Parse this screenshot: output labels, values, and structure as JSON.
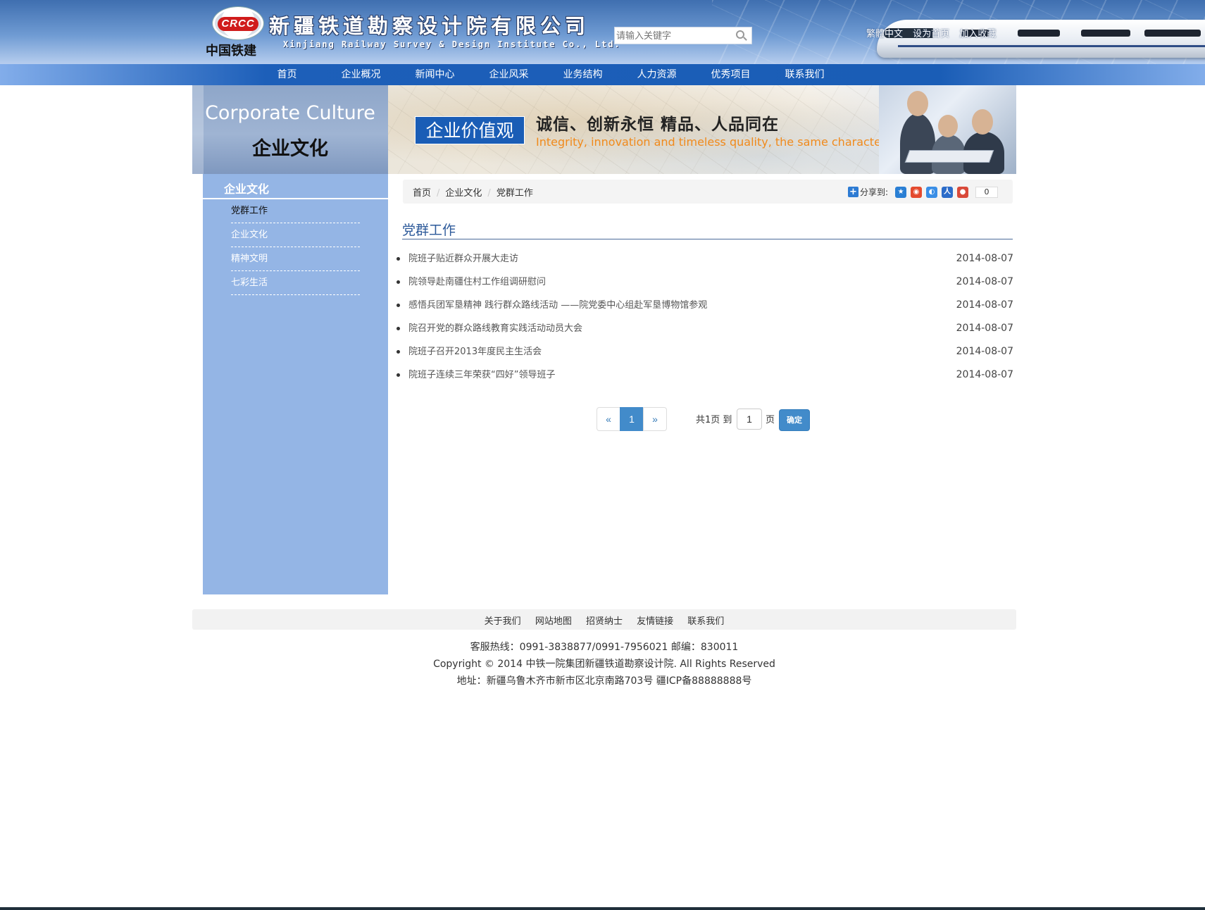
{
  "header": {
    "logo_mark": "CRCC",
    "logo_cn": "中国铁建",
    "company_name": "新疆铁道勘察设计院有限公司",
    "company_en": "Xinjiang Railway Survey & Design Institute Co., Ltd.",
    "search_placeholder": "请输入关键字",
    "top_links": [
      "繁體中文",
      "设为首页",
      "加入收藏"
    ]
  },
  "nav": {
    "items": [
      "首页",
      "企业概况",
      "新闻中心",
      "企业风采",
      "业务结构",
      "人力资源",
      "优秀项目",
      "联系我们"
    ]
  },
  "banner": {
    "title_en": "Corporate Culture",
    "title_cn": "企业文化",
    "badge": "企业价值观",
    "slogan_cn": "诚信、创新永恒   精品、人品同在",
    "slogan_en": "Integrity, innovation and timeless quality, the same character"
  },
  "sidebar": {
    "title": "企业文化",
    "items": [
      {
        "label": "党群工作",
        "active": true
      },
      {
        "label": "企业文化",
        "active": false
      },
      {
        "label": "精神文明",
        "active": false
      },
      {
        "label": "七彩生活",
        "active": false
      }
    ]
  },
  "breadcrumb": [
    "首页",
    "企业文化",
    "党群工作"
  ],
  "share": {
    "label": "分享到:",
    "count": "0"
  },
  "section_title": "党群工作",
  "articles": [
    {
      "title": "院班子贴近群众开展大走访",
      "date": "2014-08-07"
    },
    {
      "title": "院领导赴南疆住村工作组调研慰问",
      "date": "2014-08-07"
    },
    {
      "title": "感悟兵团军垦精神 践行群众路线活动 ——院党委中心组赴军垦博物馆参观",
      "date": "2014-08-07"
    },
    {
      "title": "院召开党的群众路线教育实践活动动员大会",
      "date": "2014-08-07"
    },
    {
      "title": "院班子召开2013年度民主生活会",
      "date": "2014-08-07"
    },
    {
      "title": "院班子连续三年荣获“四好”领导班子",
      "date": "2014-08-07"
    }
  ],
  "pagination": {
    "prev": "«",
    "current": "1",
    "next": "»",
    "total_text": "共1页 到",
    "input_value": "1",
    "page_suffix": "页",
    "go_label": "确定"
  },
  "footer": {
    "links": [
      "关于我们",
      "网站地图",
      "招贤纳士",
      "友情链接",
      "联系我们"
    ],
    "hotline": "客服热线：0991-3838877/0991-7956021 邮编：830011",
    "copyright": "Copyright © 2014 中铁一院集团新疆铁道勘察设计院. All Rights Reserved",
    "address": "地址：新疆乌鲁木齐市新市区北京南路703号 疆ICP备88888888号"
  },
  "colors": {
    "nav_blue": "#1a5db6",
    "sidebar_blue": "#94b5e5",
    "accent_orange": "#f08a1c",
    "pager_blue": "#428bca"
  }
}
